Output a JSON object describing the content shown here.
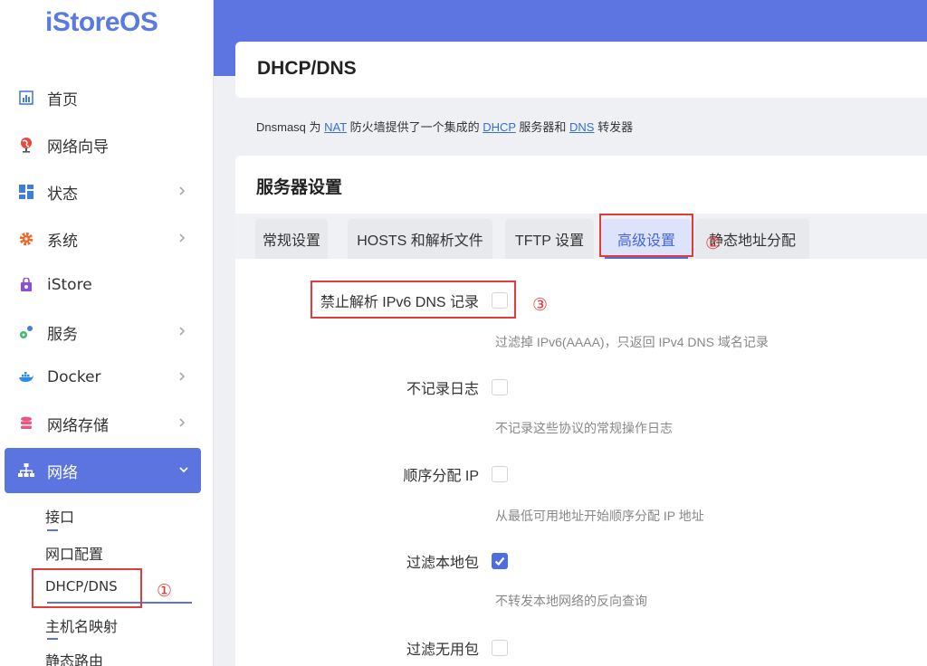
{
  "app": {
    "logo": "iStoreOS"
  },
  "sidebar": {
    "items": [
      {
        "label": "首页",
        "icon": "dashboard-icon",
        "has_chevron": false
      },
      {
        "label": "网络向导",
        "icon": "globe-pin-icon",
        "has_chevron": false
      },
      {
        "label": "状态",
        "icon": "grid-icon",
        "has_chevron": true
      },
      {
        "label": "系统",
        "icon": "gear-icon",
        "has_chevron": true
      },
      {
        "label": "iStore",
        "icon": "bag-icon",
        "has_chevron": false
      },
      {
        "label": "服务",
        "icon": "services-icon",
        "has_chevron": true
      },
      {
        "label": "Docker",
        "icon": "docker-icon",
        "has_chevron": true
      },
      {
        "label": "网络存储",
        "icon": "database-icon",
        "has_chevron": true
      },
      {
        "label": "网络",
        "icon": "network-icon",
        "has_chevron": true,
        "active": true
      }
    ],
    "sub_items": [
      "接口",
      "网口配置",
      "DHCP/DNS",
      "主机名映射",
      "静态路由"
    ]
  },
  "header": {
    "title": "DHCP/DNS"
  },
  "description": {
    "prefix": "Dnsmasq 为 ",
    "link1": "NAT",
    "mid1": " 防火墙提供了一个集成的 ",
    "link2": "DHCP",
    "mid2": " 服务器和 ",
    "link3": "DNS",
    "suffix": " 转发器"
  },
  "section": {
    "title": "服务器设置"
  },
  "tabs": [
    {
      "label": "常规设置"
    },
    {
      "label": "HOSTS 和解析文件"
    },
    {
      "label": "TFTP 设置"
    },
    {
      "label": "高级设置",
      "active": true
    },
    {
      "label": "静态地址分配"
    }
  ],
  "options": [
    {
      "label": "禁止解析 IPv6 DNS 记录",
      "checked": false,
      "hint": "过滤掉 IPv6(AAAA)，只返回 IPv4 DNS 域名记录"
    },
    {
      "label": "不记录日志",
      "checked": false,
      "hint": "不记录这些协议的常规操作日志"
    },
    {
      "label": "顺序分配 IP",
      "checked": false,
      "hint": "从最低可用地址开始顺序分配 IP 地址"
    },
    {
      "label": "过滤本地包",
      "checked": true,
      "hint": "不转发本地网络的反向查询"
    },
    {
      "label": "过滤无用包",
      "checked": false,
      "hint": ""
    }
  ],
  "annotations": [
    "①",
    "②",
    "③"
  ],
  "colors": {
    "accent": "#5c75e0",
    "annotation": "#e23b3b",
    "link": "#3a6fcf"
  }
}
